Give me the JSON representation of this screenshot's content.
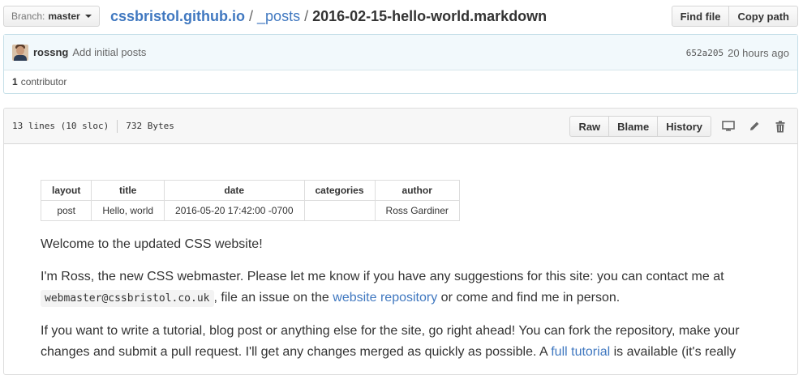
{
  "branch": {
    "label": "Branch:",
    "value": "master"
  },
  "breadcrumb": {
    "repo": "cssbristol.github.io",
    "folder": "_posts",
    "file": "2016-02-15-hello-world.markdown"
  },
  "top_actions": {
    "find_file": "Find file",
    "copy_path": "Copy path"
  },
  "commit": {
    "author": "rossng",
    "message": "Add initial posts",
    "sha": "652a205",
    "time": "20 hours ago"
  },
  "contributors": {
    "count": "1",
    "label": "contributor"
  },
  "file_header": {
    "lines": "13 lines (10 sloc)",
    "size": "732 Bytes",
    "raw": "Raw",
    "blame": "Blame",
    "history": "History"
  },
  "meta_table": {
    "headers": [
      "layout",
      "title",
      "date",
      "categories",
      "author"
    ],
    "row": [
      "post",
      "Hello, world",
      "2016-05-20 17:42:00 -0700",
      "",
      "Ross Gardiner"
    ]
  },
  "content": {
    "p1": "Welcome to the updated CSS website!",
    "p2_a": "I'm Ross, the new CSS webmaster. Please let me know if you have any suggestions for this site: you can contact me at",
    "p2_code": "webmaster@cssbristol.co.uk",
    "p2_b": ", file an issue on the",
    "p2_link": "website repository",
    "p2_c": "or come and find me in person.",
    "p3_a": "If you want to write a tutorial, blog post or anything else for the site, go right ahead! You can fork the repository, make your changes and submit a pull request. I'll get any changes merged as quickly as possible. A",
    "p3_link": "full tutorial",
    "p3_b": "is available (it's really"
  }
}
